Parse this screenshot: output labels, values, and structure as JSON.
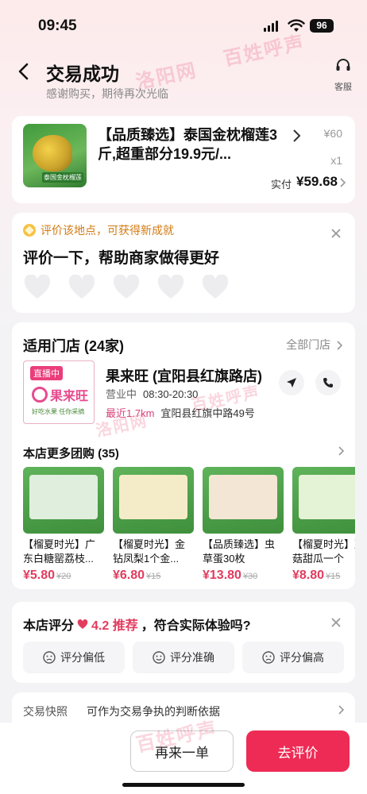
{
  "status": {
    "time": "09:45",
    "battery": "96"
  },
  "header": {
    "title": "交易成功",
    "subtitle": "感谢购买，期待再次光临",
    "service_label": "客服"
  },
  "order": {
    "name": "【品质臻选】泰国金枕榴莲3斤,超重部分19.9元/...",
    "price": "¥60",
    "qty": "x1",
    "paid_label": "实付",
    "paid": "¥59.68",
    "thumb_tag": "泰国金枕榴莲"
  },
  "review": {
    "hint": "评价该地点，可获得新成就",
    "title": "评价一下，帮助商家做得更好",
    "hearts": 5
  },
  "store": {
    "header": "适用门店 (24家)",
    "all_link": "全部门店",
    "logo_live": "直播中",
    "logo_name": "果来旺",
    "logo_slogan": "好吃水果 任你采摘",
    "name": "果来旺 (宜阳县红旗路店)",
    "hours_label": "营业中",
    "hours": "08:30-20:30",
    "distance": "最近1.7km",
    "address": "宜阳县红旗中路49号",
    "more_header": "本店更多团购 (35)",
    "products": [
      {
        "name": "【榴夏时光】广东白糖罂荔枝...",
        "price": "¥5.80",
        "orig": "¥20"
      },
      {
        "name": "【榴夏时光】金钻凤梨1个金...",
        "price": "¥6.80",
        "orig": "¥15"
      },
      {
        "name": "【品质臻选】虫草蛋30枚",
        "price": "¥13.80",
        "orig": "¥30"
      },
      {
        "name": "【榴夏时光】蘑菇甜瓜一个",
        "price": "¥8.80",
        "orig": "¥15"
      }
    ]
  },
  "rating": {
    "prefix": "本店评分",
    "score": "4.2 推荐",
    "question": "，符合实际体验吗?",
    "buttons": [
      "评分偏低",
      "评分准确",
      "评分偏高"
    ]
  },
  "snapshot": {
    "label": "交易快照",
    "text": "可作为交易争执的判断依据"
  },
  "actions": {
    "again": "再来一单",
    "review": "去评价"
  },
  "watermarks": [
    "百姓呼声",
    "洛阳网",
    "百姓呼声",
    "洛阳网",
    "百姓呼声"
  ],
  "colors": {
    "accent": "#ee2b55",
    "price": "#e23c5e",
    "hint": "#d27a12"
  }
}
